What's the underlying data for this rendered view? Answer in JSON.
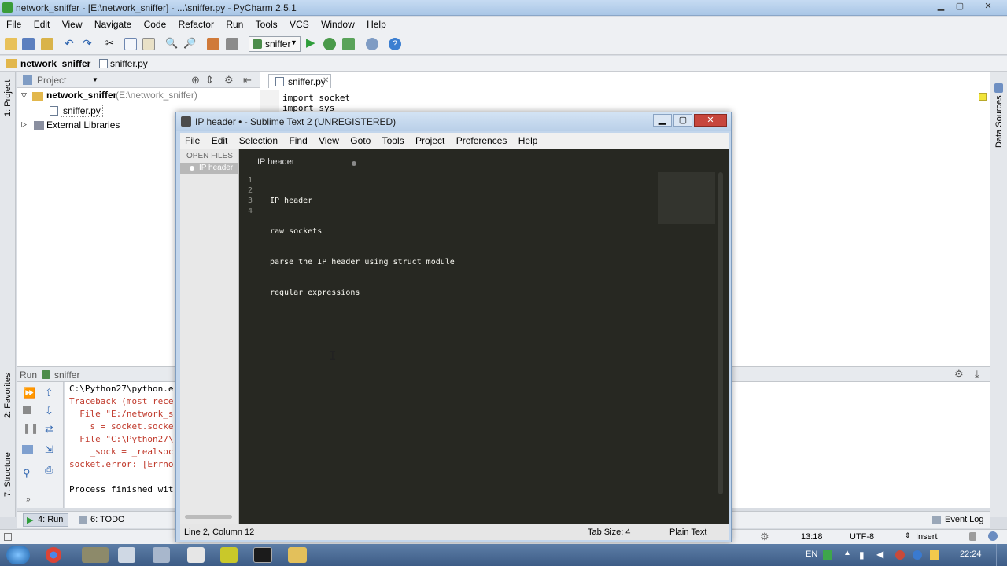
{
  "pycharm": {
    "title": "network_sniffer - [E:\\network_sniffer] - ...\\sniffer.py - PyCharm 2.5.1",
    "menu": [
      "File",
      "Edit",
      "View",
      "Navigate",
      "Code",
      "Refactor",
      "Run",
      "Tools",
      "VCS",
      "Window",
      "Help"
    ],
    "run_config": "sniffer",
    "breadcrumb": {
      "project": "network_sniffer",
      "file": "sniffer.py"
    },
    "left_tools": {
      "project_tab": "1: Project",
      "favorites": "2: Favorites",
      "structure": "7: Structure"
    },
    "right_tools": {
      "data_sources": "Data Sources"
    },
    "project_pane": {
      "header": "Project",
      "root_name": "network_sniffer",
      "root_path": "(E:\\network_sniffer)",
      "file": "sniffer.py",
      "external": "External Libraries"
    },
    "editor": {
      "tab": "sniffer.py",
      "lines": [
        "import socket",
        "import sys"
      ]
    },
    "run_panel": {
      "title": "Run",
      "config": "sniffer",
      "console": [
        "C:\\Python27\\python.e",
        "Traceback (most rece",
        "  File \"E:/network_s",
        "    s = socket.socke",
        "  File \"C:\\Python27\\",
        "    _sock = _realsoc",
        "socket.error: [Errno",
        "",
        "Process finished wit"
      ]
    },
    "bottom_tabs": {
      "run": "4: Run",
      "todo": "6: TODO",
      "event_log": "Event Log"
    },
    "status": {
      "position": "13:18",
      "encoding": "UTF-8",
      "mode": "Insert"
    }
  },
  "sublime": {
    "title": "IP header • - Sublime Text 2 (UNREGISTERED)",
    "menu": [
      "File",
      "Edit",
      "Selection",
      "Find",
      "View",
      "Goto",
      "Tools",
      "Project",
      "Preferences",
      "Help"
    ],
    "sidebar_header": "OPEN FILES",
    "sidebar_file": "IP header",
    "tab": "IP header",
    "line_numbers": [
      "1",
      "2",
      "3",
      "4"
    ],
    "lines": [
      "IP header",
      "raw sockets",
      "parse the IP header using struct module",
      "regular expressions"
    ],
    "status": {
      "position": "Line 2, Column 12",
      "tab_size": "Tab Size: 4",
      "syntax": "Plain Text"
    }
  },
  "taskbar": {
    "lang": "EN",
    "clock": "22:24"
  },
  "colors": {
    "sublime_bg": "#272822",
    "console_error": "#c0392b",
    "run_green": "#2e9d3a"
  }
}
